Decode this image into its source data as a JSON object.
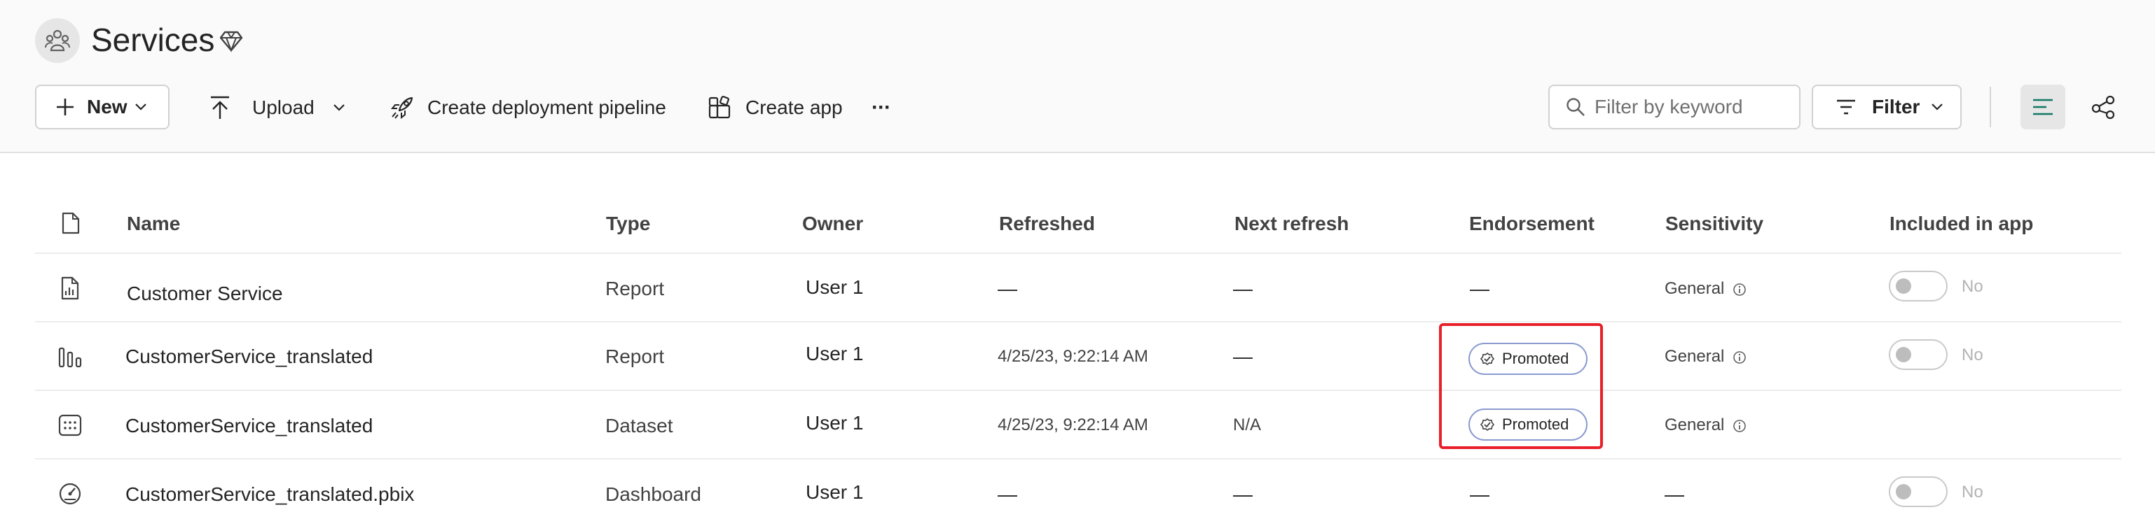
{
  "workspace": {
    "title": "Services"
  },
  "toolbar": {
    "new_label": "New",
    "upload_label": "Upload",
    "pipeline_label": "Create deployment pipeline",
    "create_app_label": "Create app",
    "more_label": "···"
  },
  "search": {
    "placeholder": "Filter by keyword"
  },
  "filter": {
    "label": "Filter"
  },
  "table": {
    "headers": {
      "name": "Name",
      "type": "Type",
      "owner": "Owner",
      "refreshed": "Refreshed",
      "next_refresh": "Next refresh",
      "endorsement": "Endorsement",
      "sensitivity": "Sensitivity",
      "included_in_app": "Included in app"
    },
    "rows": [
      {
        "icon": "report-icon",
        "name": "Customer Service",
        "type": "Report",
        "owner": "User 1",
        "refreshed": "—",
        "next_refresh": "—",
        "endorsement": "—",
        "sensitivity": "General",
        "included": "No"
      },
      {
        "icon": "bar-chart-icon",
        "name": "CustomerService_translated",
        "type": "Report",
        "owner": "User 1",
        "refreshed": "4/25/23, 9:22:14 AM",
        "next_refresh": "—",
        "endorsement": "Promoted",
        "sensitivity": "General",
        "included": "No"
      },
      {
        "icon": "dataset-icon",
        "name": "CustomerService_translated",
        "type": "Dataset",
        "owner": "User 1",
        "refreshed": "4/25/23, 9:22:14 AM",
        "next_refresh": "N/A",
        "endorsement": "Promoted",
        "sensitivity": "General",
        "included": ""
      },
      {
        "icon": "dashboard-gauge-icon",
        "name": "CustomerService_translated.pbix",
        "type": "Dashboard",
        "owner": "User 1",
        "refreshed": "—",
        "next_refresh": "—",
        "endorsement": "—",
        "sensitivity": "—",
        "included": "No"
      }
    ]
  },
  "colors": {
    "accent": "#117865",
    "highlight": "#e8202a",
    "badge_border": "#8a9ad0"
  }
}
